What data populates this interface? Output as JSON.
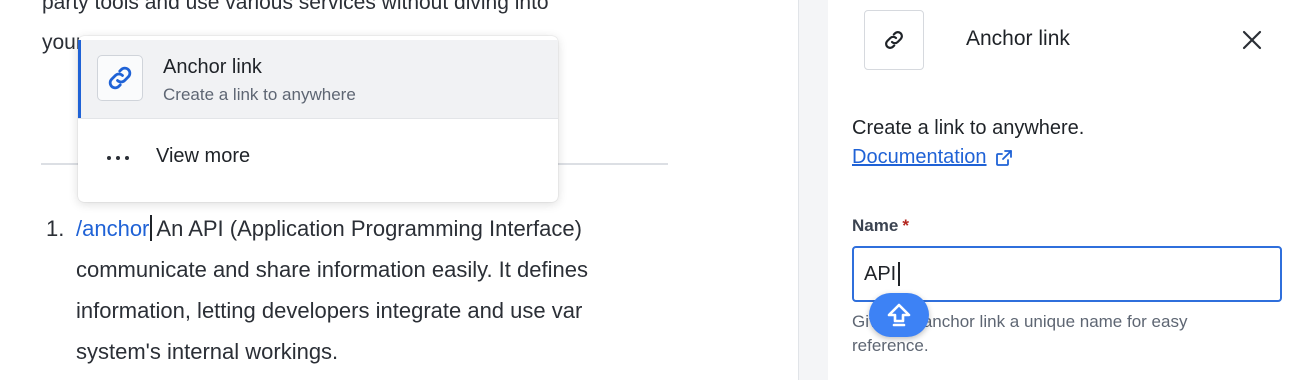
{
  "editor": {
    "bg_line1": "party tools and use various services without diving into",
    "bg_line2": "your",
    "bg_line2_tail": "system's internal workings.",
    "list": {
      "number": "1.",
      "slash_command": "/anchor",
      "line1_rest": "An API (Application Programming Interface)",
      "line2": "communicate and share information easily. It defines",
      "line3": "information, letting developers integrate and use var",
      "line4": "system's internal workings."
    }
  },
  "popup": {
    "selected": {
      "icon": "link-icon",
      "title": "Anchor link",
      "subtitle": "Create a link to anywhere"
    },
    "more": {
      "icon": "more-dots-icon",
      "label": "View more"
    }
  },
  "panel": {
    "icon": "link-icon",
    "title": "Anchor link",
    "close_icon": "close-icon",
    "description": "Create a link to anywhere.",
    "doc_link": "Documentation",
    "doc_link_icon": "external-link-icon",
    "name_label": "Name",
    "required_mark": "*",
    "name_value": "API",
    "helper_text": "Give this anchor link a unique name for easy reference."
  },
  "fab": {
    "icon": "arrow-up-icon"
  },
  "colors": {
    "accent": "#1f62d6",
    "input_border": "#2f6fdc",
    "required": "#b3261e",
    "fab": "#3d82f5"
  }
}
